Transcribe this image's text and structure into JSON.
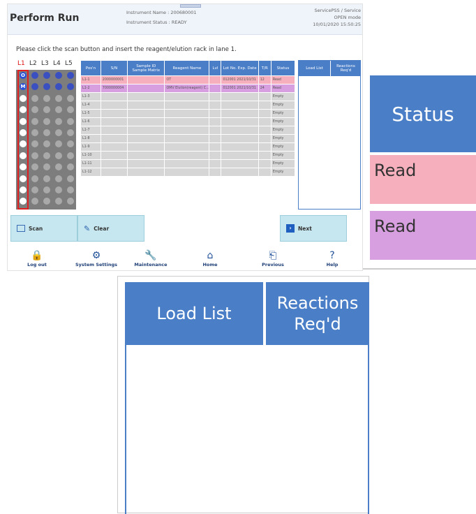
{
  "header": {
    "title": "Perform Run",
    "instrument_name": "Instrument Name : 200680001",
    "instrument_status": "Instrument Status : READY",
    "user": "ServicePSS / Service",
    "mode": "OPEN mode",
    "datetime": "10/01/2020 15:50:25"
  },
  "instruction": "Please click the scan button and insert the reagent/elution rack in lane 1.",
  "lanes": [
    "L1",
    "L2",
    "L3",
    "L4",
    "L5"
  ],
  "lane1_markers": [
    "O",
    "M"
  ],
  "table": {
    "columns": [
      "Pos'n",
      "S/N",
      "Sample ID Sample Matrix",
      "Reagent Name",
      "Lvl",
      "Lot No. Exp. Date",
      "T/R",
      "Status"
    ],
    "rows": [
      {
        "pos": "L1-1",
        "sn": "2000000001",
        "sample": "",
        "reagent": "OT",
        "lvl": "",
        "lot": "012001 2021/10/31",
        "tr": "12",
        "status": "Read",
        "style": "pink"
      },
      {
        "pos": "L1-2",
        "sn": "7000000004",
        "sample": "",
        "reagent": "OMV Elution(reagent) C...",
        "lvl": "",
        "lot": "012001 2021/10/31",
        "tr": "24",
        "status": "Read",
        "style": "violet"
      },
      {
        "pos": "L1-3",
        "sn": "",
        "sample": "",
        "reagent": "",
        "lvl": "",
        "lot": "",
        "tr": "",
        "status": "Empty",
        "style": "grey"
      },
      {
        "pos": "L1-4",
        "sn": "",
        "sample": "",
        "reagent": "",
        "lvl": "",
        "lot": "",
        "tr": "",
        "status": "Empty",
        "style": "grey"
      },
      {
        "pos": "L1-5",
        "sn": "",
        "sample": "",
        "reagent": "",
        "lvl": "",
        "lot": "",
        "tr": "",
        "status": "Empty",
        "style": "grey"
      },
      {
        "pos": "L1-6",
        "sn": "",
        "sample": "",
        "reagent": "",
        "lvl": "",
        "lot": "",
        "tr": "",
        "status": "Empty",
        "style": "grey"
      },
      {
        "pos": "L1-7",
        "sn": "",
        "sample": "",
        "reagent": "",
        "lvl": "",
        "lot": "",
        "tr": "",
        "status": "Empty",
        "style": "grey"
      },
      {
        "pos": "L1-8",
        "sn": "",
        "sample": "",
        "reagent": "",
        "lvl": "",
        "lot": "",
        "tr": "",
        "status": "Empty",
        "style": "grey"
      },
      {
        "pos": "L1-9",
        "sn": "",
        "sample": "",
        "reagent": "",
        "lvl": "",
        "lot": "",
        "tr": "",
        "status": "Empty",
        "style": "grey"
      },
      {
        "pos": "L1-10",
        "sn": "",
        "sample": "",
        "reagent": "",
        "lvl": "",
        "lot": "",
        "tr": "",
        "status": "Empty",
        "style": "grey"
      },
      {
        "pos": "L1-11",
        "sn": "",
        "sample": "",
        "reagent": "",
        "lvl": "",
        "lot": "",
        "tr": "",
        "status": "Empty",
        "style": "grey"
      },
      {
        "pos": "L1-12",
        "sn": "",
        "sample": "",
        "reagent": "",
        "lvl": "",
        "lot": "",
        "tr": "",
        "status": "Empty",
        "style": "grey"
      }
    ]
  },
  "load_list": {
    "col1": "Load List",
    "col2": "Reactions Req'd"
  },
  "buttons": {
    "scan": "Scan",
    "clear": "Clear",
    "next": "Next"
  },
  "nav": [
    {
      "label": "Log out",
      "icon": "lock-icon"
    },
    {
      "label": "System Settings",
      "icon": "gear-icon"
    },
    {
      "label": "Maintenance",
      "icon": "wrench-icon"
    },
    {
      "label": "Home",
      "icon": "home-icon"
    },
    {
      "label": "Previous",
      "icon": "previous-icon"
    },
    {
      "label": "Help",
      "icon": "help-icon"
    }
  ],
  "zoom_status": {
    "header": "Status",
    "row1": "Read",
    "row2": "Read"
  },
  "zoom_load": {
    "col1": "Load List",
    "col2": "Reactions Req'd"
  },
  "colors": {
    "header_blue": "#4a7ec7",
    "row_pink": "#f6b0bd",
    "row_violet": "#d79ee0",
    "row_grey": "#d6d6d6",
    "button": "#c6e7ef"
  }
}
